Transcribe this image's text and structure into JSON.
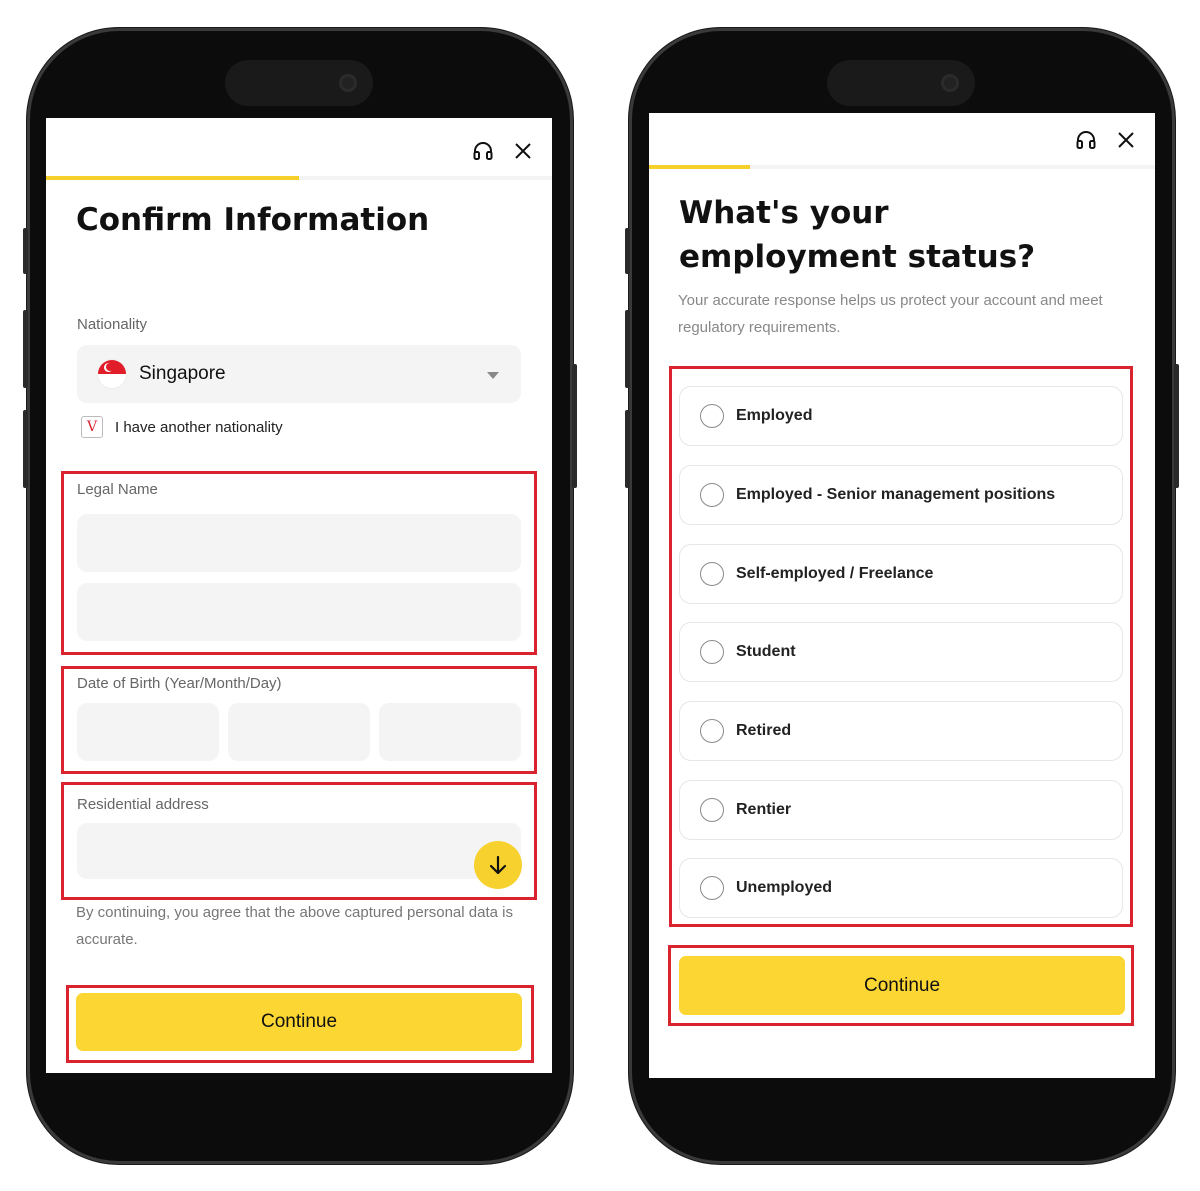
{
  "left_screen": {
    "title": "Confirm Information",
    "progress": 0.5,
    "nationality": {
      "label": "Nationality",
      "value": "Singapore",
      "flag": "singapore-flag"
    },
    "another_nationality": {
      "checkbox_mark": "V",
      "label": "I have another nationality"
    },
    "legal_name_label": "Legal Name",
    "dob_label": "Date of Birth (Year/Month/Day)",
    "address_label": "Residential address",
    "consent_text": "By continuing, you agree that the above captured personal data is accurate.",
    "continue_label": "Continue",
    "icons": [
      "headset-icon",
      "close-icon",
      "arrow-down-icon"
    ]
  },
  "right_screen": {
    "title": "What's your employment status?",
    "progress": 0.2,
    "subtitle": "Your accurate response helps us protect your account and meet regulatory requirements.",
    "options": [
      "Employed",
      "Employed - Senior management positions",
      "Self-employed / Freelance",
      "Student",
      "Retired",
      "Rentier",
      "Unemployed"
    ],
    "continue_label": "Continue",
    "icons": [
      "headset-icon",
      "close-icon"
    ]
  },
  "colors": {
    "accent": "#fcd632",
    "progress": "#f5cf2a",
    "highlight": "#d9232f"
  }
}
